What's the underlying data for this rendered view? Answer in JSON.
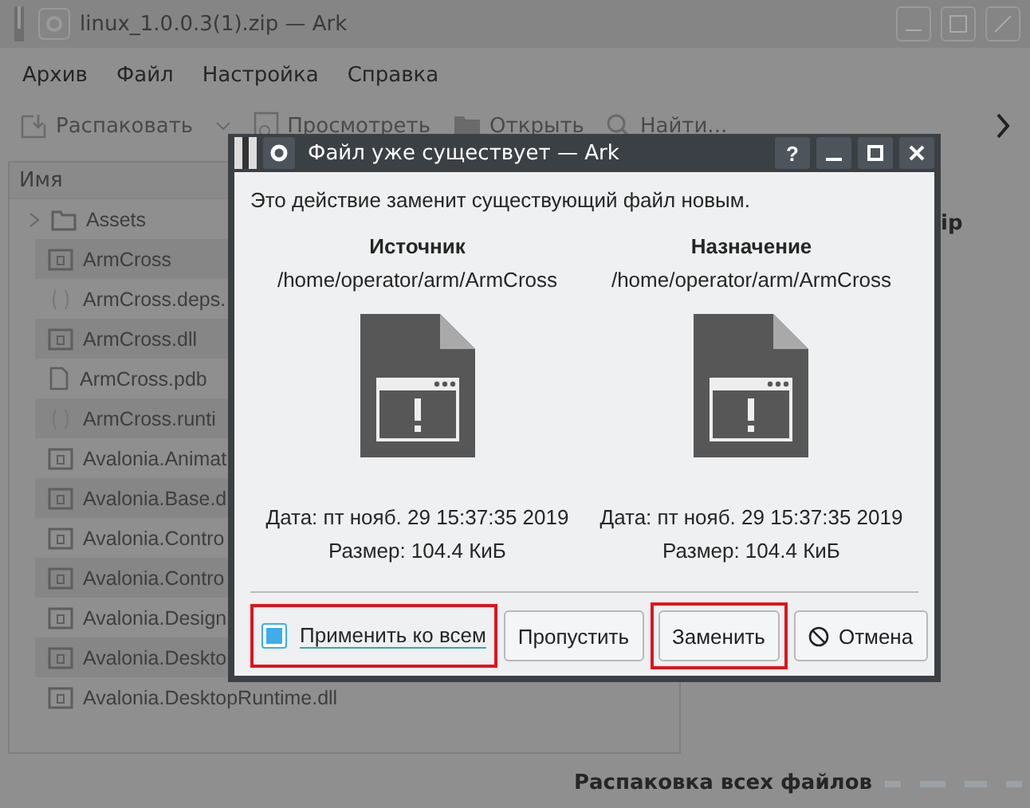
{
  "window": {
    "title": "linux_1.0.0.3(1).zip — Ark"
  },
  "menu": [
    "Архив",
    "Файл",
    "Настройка",
    "Справка"
  ],
  "toolbar": [
    {
      "label": "Распаковать",
      "kind": "extract"
    },
    {
      "label": "Просмотреть",
      "kind": "preview"
    },
    {
      "label": "Открыть",
      "kind": "open"
    },
    {
      "label": "Найти...",
      "kind": "find"
    }
  ],
  "file_list": {
    "header": "Имя",
    "items": [
      {
        "name": "Assets",
        "kind": "folder",
        "expanded": false
      },
      {
        "name": "ArmCross",
        "kind": "exe"
      },
      {
        "name": "ArmCross.deps.",
        "kind": "json"
      },
      {
        "name": "ArmCross.dll",
        "kind": "exe"
      },
      {
        "name": "ArmCross.pdb",
        "kind": "file"
      },
      {
        "name": "ArmCross.runti",
        "kind": "json"
      },
      {
        "name": "Avalonia.Animat",
        "kind": "exe"
      },
      {
        "name": "Avalonia.Base.d",
        "kind": "exe"
      },
      {
        "name": "Avalonia.Contro",
        "kind": "exe"
      },
      {
        "name": "Avalonia.Contro",
        "kind": "exe"
      },
      {
        "name": "Avalonia.Design",
        "kind": "exe"
      },
      {
        "name": "Avalonia.Deskto",
        "kind": "exe"
      },
      {
        "name": "Avalonia.DesktopRuntime.dll",
        "kind": "exe"
      }
    ]
  },
  "details": {
    "title": "ip"
  },
  "status": {
    "text": "Распаковка всех файлов"
  },
  "dialog": {
    "title": "Файл уже существует — Ark",
    "help": "?",
    "message": "Это действие заменит существующий файл новым.",
    "columns": [
      {
        "heading": "Источник",
        "path": "/home/operator/arm/ArmCross",
        "date": "Дата: пт нояб. 29 15:37:35 2019",
        "size": "Размер: 104.4 КиБ"
      },
      {
        "heading": "Назначение",
        "path": "/home/operator/arm/ArmCross",
        "date": "Дата: пт нояб. 29 15:37:35 2019",
        "size": "Размер: 104.4 КиБ"
      }
    ],
    "apply_all": {
      "label": "Применить ко всем",
      "checked": true,
      "highlighted": true
    },
    "buttons": [
      {
        "label": "Пропустить",
        "kind": "plain",
        "highlighted": false
      },
      {
        "label": "Заменить",
        "kind": "plain",
        "highlighted": true
      },
      {
        "label": "Отмена",
        "kind": "cancel",
        "highlighted": false
      }
    ]
  }
}
